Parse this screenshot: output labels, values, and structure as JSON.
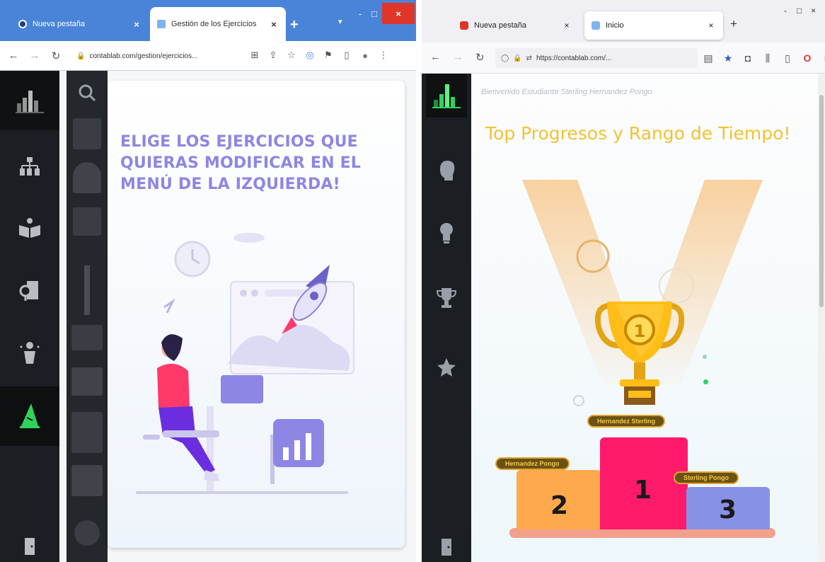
{
  "left_window": {
    "tabs": [
      {
        "title": "Nueva pestaña",
        "active": false
      },
      {
        "title": "Gestión de los Ejercicios",
        "active": true
      }
    ],
    "new_tab_label": "+",
    "window_controls": {
      "minimize": "-",
      "maximize": "□",
      "close": "×"
    },
    "address_bar": {
      "url": "contablab.com/gestion/ejercicios..."
    },
    "card": {
      "headline": "ELIGE LOS EJERCICIOS QUE QUIERAS MODIFICAR EN EL MENÚ DE LA IZQUIERDA!"
    }
  },
  "right_window": {
    "tabs": [
      {
        "title": "Nueva pestaña",
        "active": false
      },
      {
        "title": "Inicio",
        "active": true
      }
    ],
    "new_tab_label": "+",
    "window_controls": {
      "minimize": "-",
      "maximize": "□",
      "close": "×"
    },
    "address_bar": {
      "url": "https://contablab.com/..."
    },
    "welcome": "Bienvenido Estudiante Sterling Hernandez Pongo",
    "title": "Top Progresos y Rango de Tiempo!",
    "trophy_rank": "1",
    "podium": [
      {
        "place": "1",
        "color": "#ff1a6c"
      },
      {
        "place": "2",
        "color": "#ffa94d"
      },
      {
        "place": "3",
        "color": "#8792e6"
      }
    ],
    "podium_names": [
      "Hernandez Sterling",
      "Hernandez Pongo",
      "Sterling Pongo"
    ]
  },
  "colors": {
    "accent_green": "#2fd35a",
    "headline_purple": "#8d86e4",
    "title_yellow": "#f0c233",
    "chrome_blue": "#4a84d8"
  },
  "icons": {
    "left_rail": [
      "org-chart-icon",
      "book-icon",
      "location-file-icon",
      "person-icon",
      "wizard-hat-icon",
      "door-icon"
    ],
    "right_rail": [
      "head-profile-icon",
      "lightbulb-icon",
      "trophy-icon",
      "star-icon",
      "door-icon"
    ]
  }
}
